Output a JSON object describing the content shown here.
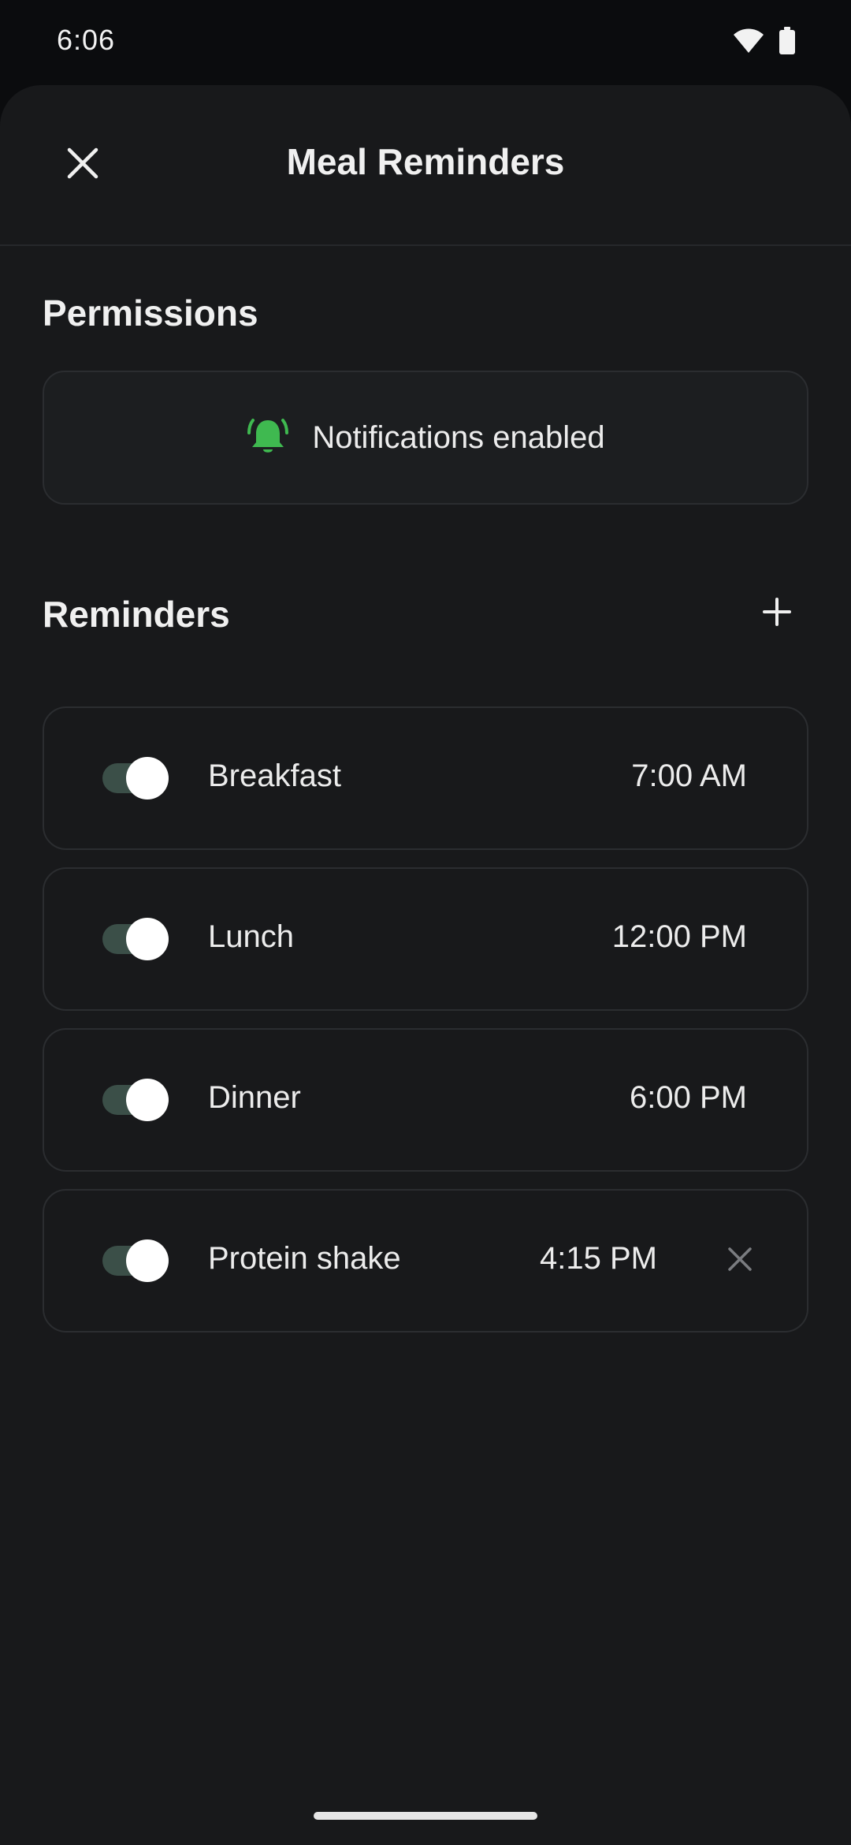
{
  "status_bar": {
    "time": "6:06",
    "icons": [
      "wifi-icon",
      "battery-icon"
    ]
  },
  "header": {
    "title": "Meal Reminders",
    "close_icon": "close-icon"
  },
  "permissions": {
    "section_title": "Permissions",
    "status_text": "Notifications enabled",
    "status_icon": "bell-ringing-icon",
    "status_color": "#3fb950"
  },
  "reminders": {
    "section_title": "Reminders",
    "add_icon": "plus-icon",
    "items": [
      {
        "label": "Breakfast",
        "time": "7:00 AM",
        "enabled": true,
        "deletable": false
      },
      {
        "label": "Lunch",
        "time": "12:00 PM",
        "enabled": true,
        "deletable": false
      },
      {
        "label": "Dinner",
        "time": "6:00 PM",
        "enabled": true,
        "deletable": false
      },
      {
        "label": "Protein shake",
        "time": "4:15 PM",
        "enabled": true,
        "deletable": true
      }
    ]
  },
  "colors": {
    "background": "#18191b",
    "toggle_track": "#3b4f48",
    "toggle_thumb": "#ffffff",
    "card_border": "#2b2d30"
  }
}
